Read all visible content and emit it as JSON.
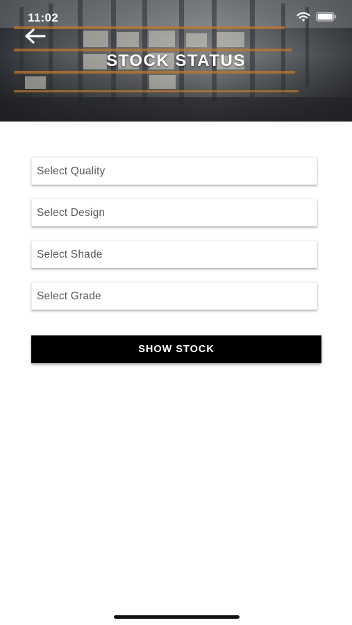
{
  "status_bar": {
    "time": "11:02",
    "wifi_icon": "wifi-icon",
    "battery_icon": "battery-icon"
  },
  "header": {
    "back_icon": "arrow-left-icon",
    "title": "STOCK STATUS",
    "background": "warehouse-shelves-image"
  },
  "form": {
    "fields": [
      {
        "placeholder": "Select Quality"
      },
      {
        "placeholder": "Select Design"
      },
      {
        "placeholder": "Select Shade"
      },
      {
        "placeholder": "Select Grade"
      }
    ],
    "submit_label": "SHOW STOCK"
  },
  "colors": {
    "button_bg": "#000000",
    "button_text": "#ffffff",
    "placeholder_text": "#5a5a5a",
    "page_bg": "#ffffff"
  }
}
